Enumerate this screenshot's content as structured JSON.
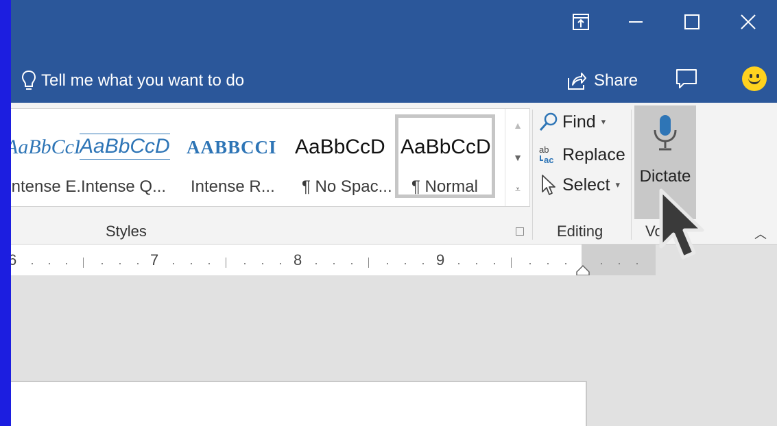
{
  "titlebar": {
    "tell_me": "Tell me what you want to do",
    "share": "Share",
    "icons": [
      "ribbon-display-options-icon",
      "minimize-icon",
      "maximize-icon",
      "close-icon",
      "lightbulb-icon",
      "share-icon",
      "comment-icon",
      "smiley-icon"
    ]
  },
  "styles": {
    "items": [
      {
        "sample": "AaBbCcDc",
        "name": "Intense E..."
      },
      {
        "sample": "AaBbCcD",
        "name": "Intense Q..."
      },
      {
        "sample": "AABBCCI",
        "name": "Intense R..."
      },
      {
        "sample": "AaBbCcD",
        "name": "¶ No Spac..."
      },
      {
        "sample": "AaBbCcD",
        "name": "¶ Normal"
      }
    ],
    "selected": "¶ Normal",
    "group_label": "Styles"
  },
  "editing": {
    "find": "Find",
    "replace": "Replace",
    "select": "Select",
    "group_label": "Editing"
  },
  "voice": {
    "dictate": "Dictate",
    "group_label": "Vo"
  },
  "ruler": {
    "numbers": [
      "6",
      "7",
      "8",
      "9"
    ]
  },
  "colors": {
    "titlebar": "#2b579a",
    "outer_frame": "#1c1ee0",
    "accent_blue": "#2e75b6",
    "smiley": "#ffd21f"
  }
}
